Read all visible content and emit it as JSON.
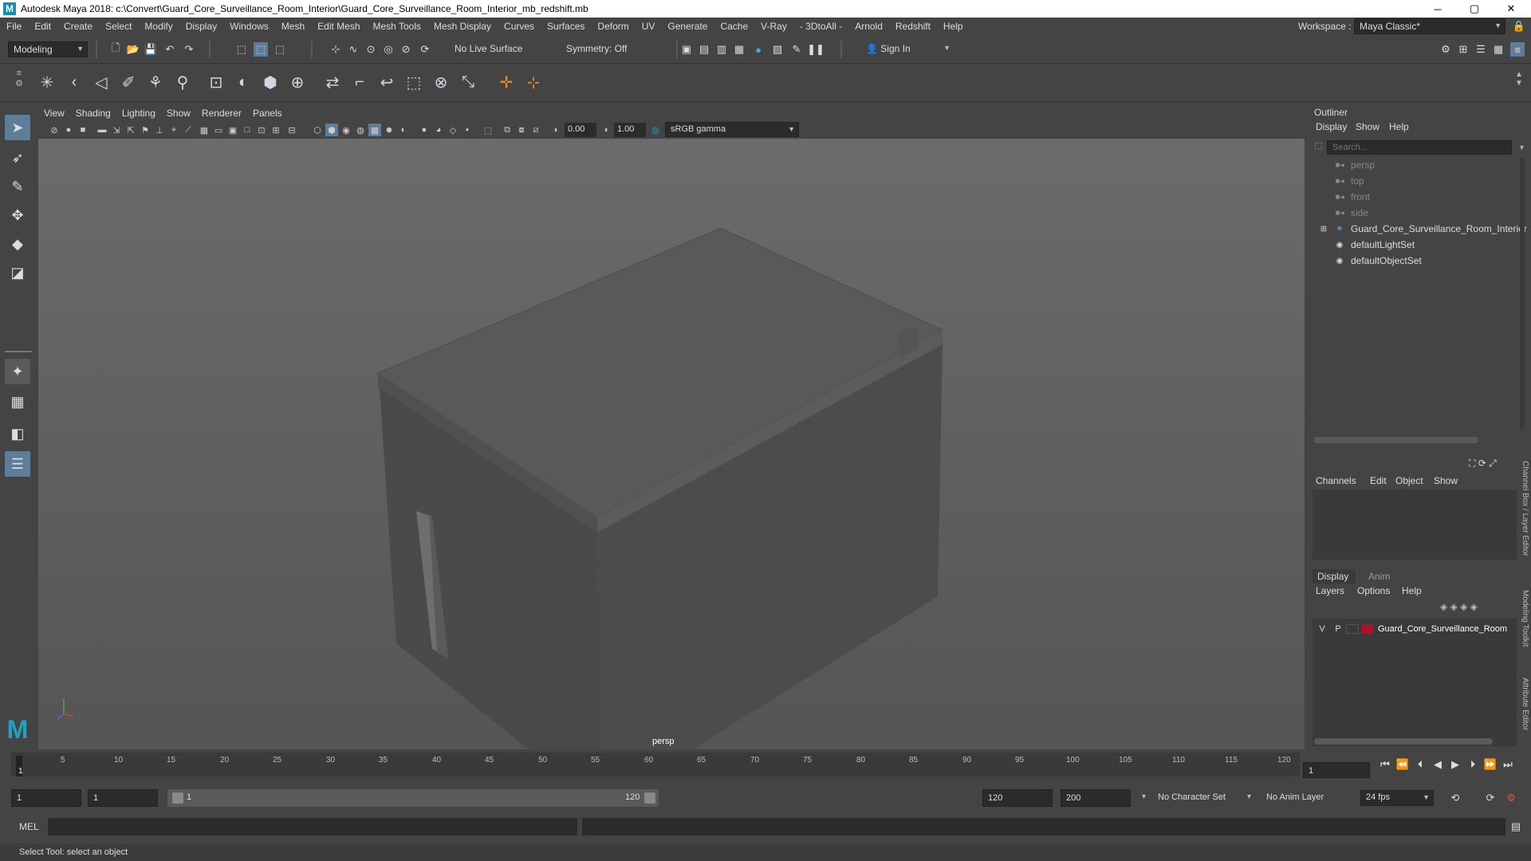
{
  "window": {
    "title": "Autodesk Maya 2018: c:\\Convert\\Guard_Core_Surveillance_Room_Interior\\Guard_Core_Surveillance_Room_Interior_mb_redshift.mb",
    "logo_letter": "M",
    "min": "─",
    "max": "▢",
    "close": "✕"
  },
  "menubar": {
    "items": [
      "File",
      "Edit",
      "Create",
      "Select",
      "Modify",
      "Display",
      "Windows",
      "Mesh",
      "Edit Mesh",
      "Mesh Tools",
      "Mesh Display",
      "Curves",
      "Surfaces",
      "Deform",
      "UV",
      "Generate",
      "Cache",
      "V-Ray",
      "- 3DtoAll -",
      "Arnold",
      "Redshift",
      "Help"
    ],
    "workspace_label": "Workspace :",
    "workspace_value": "Maya Classic*"
  },
  "statusline": {
    "mode": "Modeling",
    "live_surface": "No Live Surface",
    "symmetry": "Symmetry: Off",
    "sign_in": "Sign In"
  },
  "viewport": {
    "menu": [
      "View",
      "Shading",
      "Lighting",
      "Show",
      "Renderer",
      "Panels"
    ],
    "exposure": "0.00",
    "gamma": "1.00",
    "color_space": "sRGB gamma",
    "camera_label": "persp"
  },
  "outliner": {
    "title": "Outliner",
    "menu": [
      "Display",
      "Show",
      "Help"
    ],
    "search_placeholder": "Search...",
    "items": [
      {
        "label": "persp",
        "dim": true,
        "icon": "camera-icon"
      },
      {
        "label": "top",
        "dim": true,
        "icon": "camera-icon"
      },
      {
        "label": "front",
        "dim": true,
        "icon": "camera-icon"
      },
      {
        "label": "side",
        "dim": true,
        "icon": "camera-icon"
      },
      {
        "label": "Guard_Core_Surveillance_Room_Interior",
        "dim": false,
        "icon": "group-icon",
        "expand": "⊞"
      },
      {
        "label": "defaultLightSet",
        "dim": false,
        "icon": "set-icon"
      },
      {
        "label": "defaultObjectSet",
        "dim": false,
        "icon": "set-icon"
      }
    ]
  },
  "channelbox": {
    "menu": [
      "Channels",
      "Edit",
      "Object",
      "Show"
    ]
  },
  "layereditor": {
    "tabs": [
      "Display",
      "Anim"
    ],
    "menu": [
      "Layers",
      "Options",
      "Help"
    ],
    "layer": {
      "v": "V",
      "p": "P",
      "name": "Guard_Core_Surveillance_Room",
      "color": "#b01030"
    }
  },
  "sidetabs": [
    "Channel Box / Layer Editor",
    "Modeling Toolkit",
    "Attribute Editor"
  ],
  "timeslider": {
    "ticks": [
      "5",
      "10",
      "15",
      "20",
      "25",
      "30",
      "35",
      "40",
      "45",
      "50",
      "55",
      "60",
      "65",
      "70",
      "75",
      "80",
      "85",
      "90",
      "95",
      "100",
      "105",
      "110",
      "115",
      "120"
    ],
    "start_tick": "1",
    "current_frame": "1"
  },
  "range": {
    "start": "1",
    "playback_start": "1",
    "slider_start": "1",
    "slider_end": "120",
    "playback_end": "120",
    "end": "200",
    "character_set": "No Character Set",
    "anim_layer": "No Anim Layer",
    "fps": "24 fps"
  },
  "cmd": {
    "label": "MEL"
  },
  "help": {
    "text": "Select Tool: select an object"
  }
}
